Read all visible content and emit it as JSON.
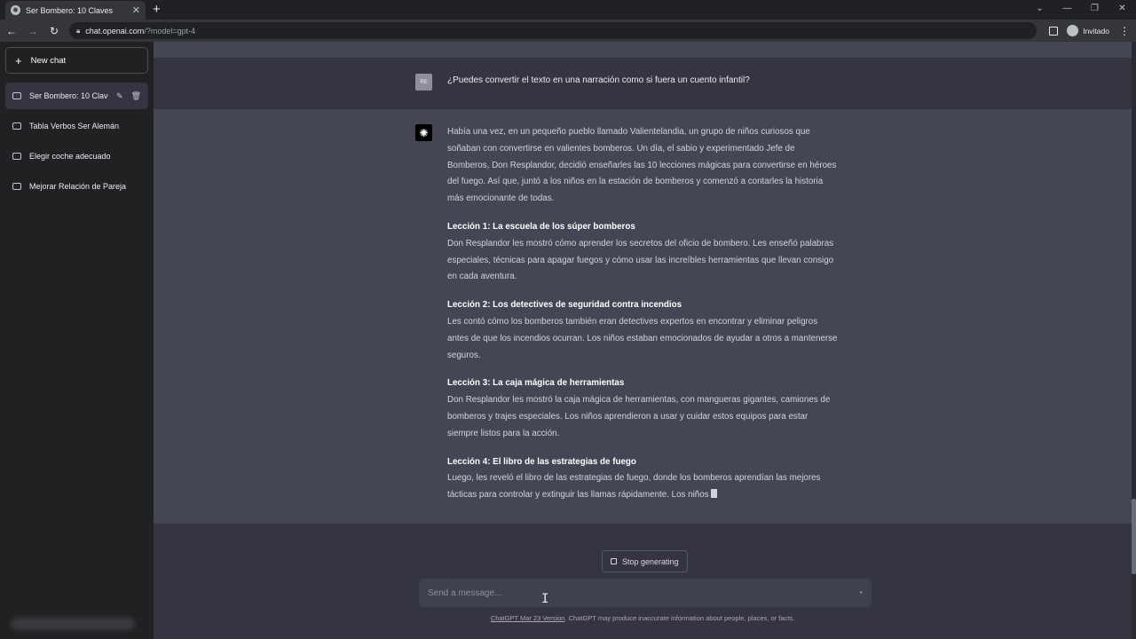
{
  "browser": {
    "tab_title": "Ser Bombero: 10 Claves",
    "tab_close": "✕",
    "new_tab": "+",
    "url_host": "chat.openai.com",
    "url_path": "/?model=gpt-4",
    "profile_label": "Invitado",
    "window_controls": [
      "⌄",
      "—",
      "❐",
      "✕"
    ]
  },
  "sidebar": {
    "new_chat_label": "New chat",
    "conversations": [
      {
        "label": "Ser Bombero: 10 Claves",
        "active": true
      },
      {
        "label": "Tabla Verbos Ser Alemán",
        "active": false
      },
      {
        "label": "Elegir coche adecuado",
        "active": false
      },
      {
        "label": "Mejorar Relación de Pareja",
        "active": false
      }
    ]
  },
  "user_message": {
    "avatar_text": "RE",
    "text": "¿Puedes convertir el texto en una narración como si fuera un cuento infantil?"
  },
  "assistant_message": {
    "intro": "Había una vez, en un pequeño pueblo llamado Valientelandia, un grupo de niños curiosos que soñaban con convertirse en valientes bomberos. Un día, el sabio y experimentado Jefe de Bomberos, Don Resplandor, decidió enseñarles las 10 lecciones mágicas para convertirse en héroes del fuego. Así que, juntó a los niños en la estación de bomberos y comenzó a contarles la historia más emocionante de todas.",
    "lessons": [
      {
        "title": "Lección 1: La escuela de los súper bomberos",
        "text": "Don Resplandor les mostró cómo aprender los secretos del oficio de bombero. Les enseñó palabras especiales, técnicas para apagar fuegos y cómo usar las increíbles herramientas que llevan consigo en cada aventura."
      },
      {
        "title": "Lección 2: Los detectives de seguridad contra incendios",
        "text": "Les contó cómo los bomberos también eran detectives expertos en encontrar y eliminar peligros antes de que los incendios ocurran. Los niños estaban emocionados de ayudar a otros a mantenerse seguros."
      },
      {
        "title": "Lección 3: La caja mágica de herramientas",
        "text": "Don Resplandor les mostró la caja mágica de herramientas, con mangueras gigantes, camiones de bomberos y trajes especiales. Los niños aprendieron a usar y cuidar estos equipos para estar siempre listos para la acción."
      },
      {
        "title": "Lección 4: El libro de las estrategias de fuego",
        "text": "Luego, les reveló el libro de las estrategias de fuego, donde los bomberos aprendían las mejores tácticas para controlar y extinguir las llamas rápidamente. Los niños"
      }
    ]
  },
  "controls": {
    "stop_label": "Stop generating",
    "input_placeholder": "Send a message...",
    "footer_link": "ChatGPT Mar 23 Version",
    "footer_text": ". ChatGPT may produce inaccurate information about people, places, or facts."
  }
}
